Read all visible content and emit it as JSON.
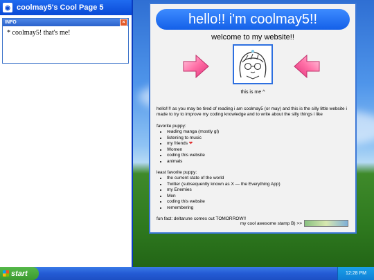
{
  "left_window": {
    "title": "coolmay5's Cool Page 5",
    "info_panel": {
      "header": "INFO",
      "close_symbol": "×",
      "text": "* coolmay5! that's me!"
    }
  },
  "main_window": {
    "banner": "hello!! i'm coolmay5!!",
    "subtitle": "welcome to my website!!",
    "avatar_caption": "this is me ^",
    "intro": "hello!!!! as you may be tired of reading i am coolmay5 (or may) and this is the silly little website i made to try to improve my coding knowledge and to write about the silly things i like",
    "favorites_heading": "favorite puppy:",
    "favorites": [
      "reading manga (mostly gl)",
      "listening to music",
      "my friends",
      "Women",
      "coding this website",
      "animals"
    ],
    "heart": "❤",
    "least_favorites_heading": "least favorite puppy:",
    "least_favorites": [
      "the current state of the world",
      "Twitter (subsequently known as X — the Everything App)",
      "my Enemies",
      "Men",
      "coding this website",
      "remembering"
    ],
    "fun_fact": "fun fact: deltarune comes out TOMORROW!!",
    "stamp_label": "my cool awesome stamp B) >>"
  },
  "taskbar": {
    "start_label": "start",
    "clock": "12:28 PM"
  },
  "colors": {
    "banner_blue": "#1460e8",
    "arrow_pink": "#ff6fa6",
    "title_blue": "#0a4ad6"
  }
}
